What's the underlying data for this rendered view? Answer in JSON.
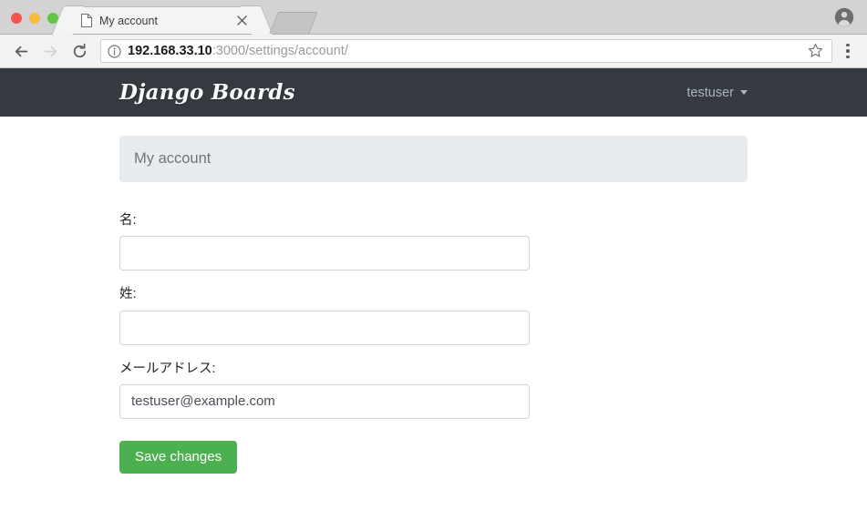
{
  "browser": {
    "window_controls": [
      "close",
      "minimize",
      "maximize"
    ],
    "tab": {
      "title": "My account",
      "page_icon": "page-icon",
      "close_icon": "close-icon"
    },
    "toolbar": {
      "back_icon": "back-arrow-icon",
      "forward_icon": "forward-arrow-icon",
      "reload_icon": "reload-icon",
      "info_icon": "info-icon",
      "star_icon": "star-icon",
      "menu_icon": "kebab-menu-icon",
      "profile_icon": "profile-avatar-icon",
      "url_host": "192.168.33.10",
      "url_rest": ":3000/settings/account/"
    }
  },
  "navbar": {
    "brand": "Django Boards",
    "user": "testuser",
    "caret_icon": "chevron-down-icon"
  },
  "page": {
    "heading": "My account",
    "form": {
      "fields": [
        {
          "label": "名:",
          "value": "",
          "placeholder": "",
          "name": "first-name"
        },
        {
          "label": "姓:",
          "value": "",
          "placeholder": "",
          "name": "last-name"
        },
        {
          "label": "メールアドレス:",
          "value": "testuser@example.com",
          "placeholder": "",
          "name": "email"
        }
      ],
      "submit_label": "Save changes"
    }
  },
  "colors": {
    "navbar_bg": "#343a40",
    "heading_bg": "#e9ecef",
    "button_green": "#4caf50",
    "input_border": "#ced4da",
    "muted_text": "#6c757d"
  }
}
